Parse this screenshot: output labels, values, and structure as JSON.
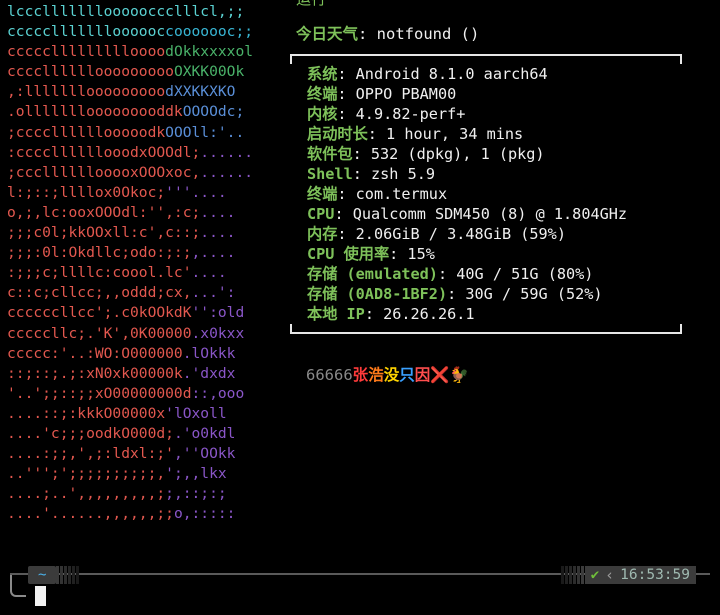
{
  "colors": {
    "background": "#000000",
    "label_green": "#7ec15a",
    "value_white": "#f0f0f0",
    "prompt_dir": "#4ab0e8",
    "check_green": "#6fbf3a"
  },
  "logo": {
    "rows": [
      [
        [
          "lcccllllllloooooccclllcl,;;",
          "#5ad2d2"
        ]
      ],
      [
        [
          "cccccllllllloooooc",
          "#5ad2d2"
        ],
        [
          "cooooooc;;",
          "#38b6d4"
        ]
      ],
      [
        [
          "cccccllllllllloooo",
          "#e3584f"
        ],
        [
          "dOkkxxxxol",
          "#4ab36a"
        ]
      ],
      [
        [
          "ccccllllllooooooooo",
          "#e3584f"
        ],
        [
          "OXKK00Ok",
          "#4ab36a"
        ]
      ],
      [
        [
          ",:lllllllooooooooo",
          "#e3584f"
        ],
        [
          "dXXKKXKO",
          "#5a8fd8"
        ]
      ],
      [
        [
          ".olllllllooooooooddk",
          "#e3584f"
        ],
        [
          "OOOOdc;",
          "#5a8fd8"
        ]
      ],
      [
        [
          ";ccccllllllooooodk",
          "#e3584f"
        ],
        [
          "OOOll:'..",
          "#5a8fd8"
        ]
      ],
      [
        [
          ":ccccllllllooodxOOOdl;",
          "#e3584f"
        ],
        [
          "......",
          "#8a56c8"
        ]
      ],
      [
        [
          ";cccllllllooooxOOOxoc,",
          "#e3584f"
        ],
        [
          "......",
          "#8a56c8"
        ]
      ],
      [
        [
          "l:;::;llllox0Okoc;",
          "#e3584f"
        ],
        [
          "'''....",
          "#8a56c8"
        ]
      ],
      [
        [
          "o,;,lc:ooxOOOdl:'',:c;",
          "#e3584f"
        ],
        [
          "....",
          "#8a56c8"
        ]
      ],
      [
        [
          ";;;c0l;kkOOxll:c',c::;",
          "#e3584f"
        ],
        [
          "....",
          "#8a56c8"
        ]
      ],
      [
        [
          ";;;:0l:Okdllc;odo:;:;",
          "#e3584f"
        ],
        [
          ",....",
          "#8a56c8"
        ]
      ],
      [
        [
          ":;;;c;llllc:coool.lc'",
          "#e3584f"
        ],
        [
          "....",
          "#8a56c8"
        ]
      ],
      [
        [
          "c::c;cllcc;,,oddd;cx,",
          "#e3584f"
        ],
        [
          "...':",
          "#8a56c8"
        ]
      ],
      [
        [
          "ccccccllcc';.c0kOOkdK",
          "#e3584f"
        ],
        [
          "'':old",
          "#8a56c8"
        ]
      ],
      [
        [
          "cccccllc;.'K',0K00000",
          "#e3584f"
        ],
        [
          ".x0kxx",
          "#8a56c8"
        ]
      ],
      [
        [
          "ccccc:'..:WO:O000000",
          "#e3584f"
        ],
        [
          ".lOkkk",
          "#8a56c8"
        ]
      ],
      [
        [
          "::;::;.;:xN0xk00000k",
          "#e3584f"
        ],
        [
          ".'dxdx",
          "#8a56c8"
        ]
      ],
      [
        [
          "'..';;::;;xO00000000d",
          "#e3584f"
        ],
        [
          "::,ooo",
          "#8a56c8"
        ]
      ],
      [
        [
          "....::;:kkkO00000x",
          "#e3584f"
        ],
        [
          "'lOxoll",
          "#8a56c8"
        ]
      ],
      [
        [
          "....'c;;;oodkO000d;",
          "#e3584f"
        ],
        [
          ".'o0kdl",
          "#8a56c8"
        ]
      ],
      [
        [
          "....:;;,',;:ldxl:;'",
          "#e3584f"
        ],
        [
          ",''OOkk",
          "#8a56c8"
        ]
      ],
      [
        [
          "..''';';;;;;;;;;;,",
          "#e3584f"
        ],
        [
          "';,,lkx",
          "#8a56c8"
        ]
      ],
      [
        [
          "....;..',,,,,,,,,;",
          "#e3584f"
        ],
        [
          ";,::;:;",
          "#8a56c8"
        ]
      ],
      [
        [
          "....'......,,,,,,;;",
          "#e3584f"
        ],
        [
          "o,:::::",
          "#8a56c8"
        ]
      ]
    ]
  },
  "topcut": "运行   ",
  "weather": {
    "label": "今日天气",
    "value": ": notfound ()"
  },
  "info": {
    "rows": [
      {
        "key": "系统",
        "value": ": Android 8.1.0 aarch64"
      },
      {
        "key": "终端",
        "value": ": OPPO PBAM00"
      },
      {
        "key": "内核",
        "value": ": 4.9.82-perf+"
      },
      {
        "key": "启动时长",
        "value": ": 1 hour, 34 mins"
      },
      {
        "key": "软件包",
        "value": ": 532 (dpkg), 1 (pkg)"
      },
      {
        "key": "Shell",
        "value": ": zsh 5.9"
      },
      {
        "key": "终端",
        "value": ": com.termux"
      },
      {
        "key": "CPU",
        "value": ": Qualcomm SDM450 (8) @ 1.804GHz"
      },
      {
        "key": "内存",
        "value": ": 2.06GiB / 3.48GiB (59%)"
      },
      {
        "key": "CPU 使用率",
        "value": ": 15%"
      },
      {
        "key": "存储 (emulated)",
        "value": ": 40G / 51G (80%)"
      },
      {
        "key": "存储 (0AD8-1BF2)",
        "value": ": 30G / 59G (52%)"
      },
      {
        "key": "本地 IP",
        "value": ": 26.26.26.1"
      }
    ]
  },
  "tags": {
    "number": "66666",
    "c1": "张",
    "c2": "浩",
    "c3": "没",
    "c4": "只",
    "c5": "因",
    "c6": "❌",
    "c7": "🐓"
  },
  "prompt": {
    "dir": "~",
    "status": "✔",
    "time": "16:53:59"
  }
}
